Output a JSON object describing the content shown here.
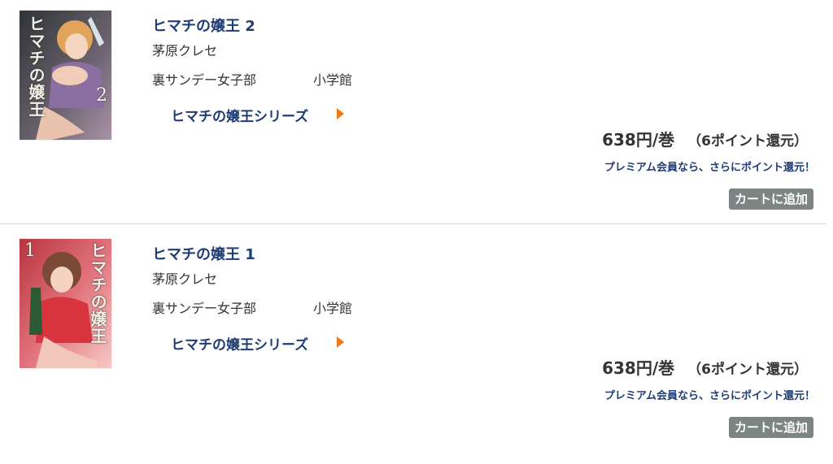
{
  "items": [
    {
      "title": "ヒマチの嬢王 2",
      "author": "茅原クレセ",
      "label": "裏サンデー女子部",
      "publisher": "小学館",
      "series": "ヒマチの嬢王シリーズ",
      "price": "638円/巻",
      "points": "（6ポイント還元）",
      "premium": "プレミアム会員なら、さらにポイント還元！",
      "cart": "カートに追加",
      "cover_title": "ヒマチの嬢王",
      "cover_vol": "2",
      "cover_colors": [
        "#3b3f42",
        "#8a7d8f"
      ]
    },
    {
      "title": "ヒマチの嬢王 1",
      "author": "茅原クレセ",
      "label": "裏サンデー女子部",
      "publisher": "小学館",
      "series": "ヒマチの嬢王シリーズ",
      "price": "638円/巻",
      "points": "（6ポイント還元）",
      "premium": "プレミアム会員なら、さらにポイント還元！",
      "cart": "カートに追加",
      "cover_title": "ヒマチの嬢王",
      "cover_vol": "1",
      "cover_colors": [
        "#c8505a",
        "#f2b9b4"
      ]
    }
  ]
}
